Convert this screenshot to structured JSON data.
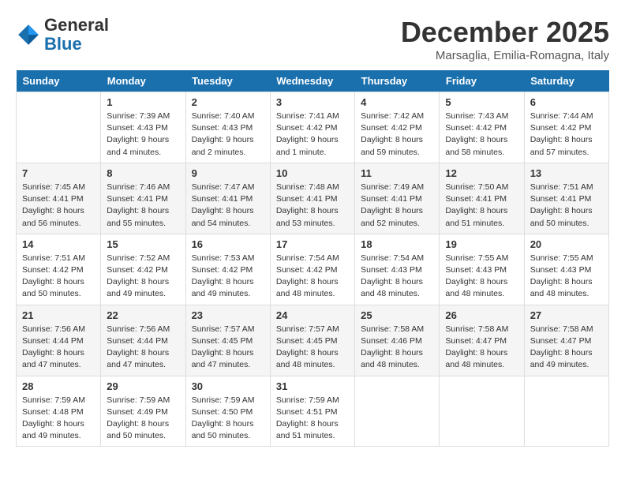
{
  "header": {
    "logo_line1": "General",
    "logo_line2": "Blue",
    "month": "December 2025",
    "location": "Marsaglia, Emilia-Romagna, Italy"
  },
  "weekdays": [
    "Sunday",
    "Monday",
    "Tuesday",
    "Wednesday",
    "Thursday",
    "Friday",
    "Saturday"
  ],
  "weeks": [
    [
      {
        "day": "",
        "info": ""
      },
      {
        "day": "1",
        "info": "Sunrise: 7:39 AM\nSunset: 4:43 PM\nDaylight: 9 hours\nand 4 minutes."
      },
      {
        "day": "2",
        "info": "Sunrise: 7:40 AM\nSunset: 4:43 PM\nDaylight: 9 hours\nand 2 minutes."
      },
      {
        "day": "3",
        "info": "Sunrise: 7:41 AM\nSunset: 4:42 PM\nDaylight: 9 hours\nand 1 minute."
      },
      {
        "day": "4",
        "info": "Sunrise: 7:42 AM\nSunset: 4:42 PM\nDaylight: 8 hours\nand 59 minutes."
      },
      {
        "day": "5",
        "info": "Sunrise: 7:43 AM\nSunset: 4:42 PM\nDaylight: 8 hours\nand 58 minutes."
      },
      {
        "day": "6",
        "info": "Sunrise: 7:44 AM\nSunset: 4:42 PM\nDaylight: 8 hours\nand 57 minutes."
      }
    ],
    [
      {
        "day": "7",
        "info": "Sunrise: 7:45 AM\nSunset: 4:41 PM\nDaylight: 8 hours\nand 56 minutes."
      },
      {
        "day": "8",
        "info": "Sunrise: 7:46 AM\nSunset: 4:41 PM\nDaylight: 8 hours\nand 55 minutes."
      },
      {
        "day": "9",
        "info": "Sunrise: 7:47 AM\nSunset: 4:41 PM\nDaylight: 8 hours\nand 54 minutes."
      },
      {
        "day": "10",
        "info": "Sunrise: 7:48 AM\nSunset: 4:41 PM\nDaylight: 8 hours\nand 53 minutes."
      },
      {
        "day": "11",
        "info": "Sunrise: 7:49 AM\nSunset: 4:41 PM\nDaylight: 8 hours\nand 52 minutes."
      },
      {
        "day": "12",
        "info": "Sunrise: 7:50 AM\nSunset: 4:41 PM\nDaylight: 8 hours\nand 51 minutes."
      },
      {
        "day": "13",
        "info": "Sunrise: 7:51 AM\nSunset: 4:41 PM\nDaylight: 8 hours\nand 50 minutes."
      }
    ],
    [
      {
        "day": "14",
        "info": "Sunrise: 7:51 AM\nSunset: 4:42 PM\nDaylight: 8 hours\nand 50 minutes."
      },
      {
        "day": "15",
        "info": "Sunrise: 7:52 AM\nSunset: 4:42 PM\nDaylight: 8 hours\nand 49 minutes."
      },
      {
        "day": "16",
        "info": "Sunrise: 7:53 AM\nSunset: 4:42 PM\nDaylight: 8 hours\nand 49 minutes."
      },
      {
        "day": "17",
        "info": "Sunrise: 7:54 AM\nSunset: 4:42 PM\nDaylight: 8 hours\nand 48 minutes."
      },
      {
        "day": "18",
        "info": "Sunrise: 7:54 AM\nSunset: 4:43 PM\nDaylight: 8 hours\nand 48 minutes."
      },
      {
        "day": "19",
        "info": "Sunrise: 7:55 AM\nSunset: 4:43 PM\nDaylight: 8 hours\nand 48 minutes."
      },
      {
        "day": "20",
        "info": "Sunrise: 7:55 AM\nSunset: 4:43 PM\nDaylight: 8 hours\nand 48 minutes."
      }
    ],
    [
      {
        "day": "21",
        "info": "Sunrise: 7:56 AM\nSunset: 4:44 PM\nDaylight: 8 hours\nand 47 minutes."
      },
      {
        "day": "22",
        "info": "Sunrise: 7:56 AM\nSunset: 4:44 PM\nDaylight: 8 hours\nand 47 minutes."
      },
      {
        "day": "23",
        "info": "Sunrise: 7:57 AM\nSunset: 4:45 PM\nDaylight: 8 hours\nand 47 minutes."
      },
      {
        "day": "24",
        "info": "Sunrise: 7:57 AM\nSunset: 4:45 PM\nDaylight: 8 hours\nand 48 minutes."
      },
      {
        "day": "25",
        "info": "Sunrise: 7:58 AM\nSunset: 4:46 PM\nDaylight: 8 hours\nand 48 minutes."
      },
      {
        "day": "26",
        "info": "Sunrise: 7:58 AM\nSunset: 4:47 PM\nDaylight: 8 hours\nand 48 minutes."
      },
      {
        "day": "27",
        "info": "Sunrise: 7:58 AM\nSunset: 4:47 PM\nDaylight: 8 hours\nand 49 minutes."
      }
    ],
    [
      {
        "day": "28",
        "info": "Sunrise: 7:59 AM\nSunset: 4:48 PM\nDaylight: 8 hours\nand 49 minutes."
      },
      {
        "day": "29",
        "info": "Sunrise: 7:59 AM\nSunset: 4:49 PM\nDaylight: 8 hours\nand 50 minutes."
      },
      {
        "day": "30",
        "info": "Sunrise: 7:59 AM\nSunset: 4:50 PM\nDaylight: 8 hours\nand 50 minutes."
      },
      {
        "day": "31",
        "info": "Sunrise: 7:59 AM\nSunset: 4:51 PM\nDaylight: 8 hours\nand 51 minutes."
      },
      {
        "day": "",
        "info": ""
      },
      {
        "day": "",
        "info": ""
      },
      {
        "day": "",
        "info": ""
      }
    ]
  ]
}
